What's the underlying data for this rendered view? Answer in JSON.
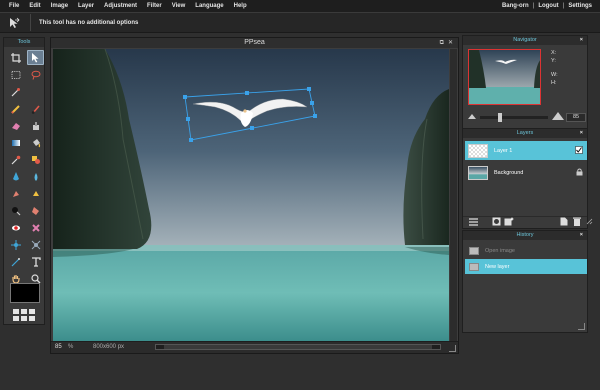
{
  "menubar": {
    "items": [
      "File",
      "Edit",
      "Image",
      "Layer",
      "Adjustment",
      "Filter",
      "View",
      "Language",
      "Help"
    ],
    "account": {
      "user": "Bang-orn",
      "logout": "Logout",
      "settings": "Settings",
      "sep": "|"
    }
  },
  "optionsbar": {
    "message": "This tool has no additional options",
    "tool_icon": "move-icon"
  },
  "tools": {
    "title": "Tools",
    "items": [
      "crop-icon",
      "move-icon",
      "marquee-icon",
      "lasso-icon",
      "wand-icon",
      "pencil-icon",
      "brush-icon",
      "clone-icon",
      "eraser-icon",
      "bucket-icon",
      "gradient-icon",
      "colorpicker-icon",
      "drawing-icon",
      "burn-icon",
      "blur-icon",
      "sharpen-icon",
      "smudge-icon",
      "sponge-icon",
      "dodge-icon",
      "redeye-icon",
      "spot-heal-icon",
      "bloat-icon",
      "pinch-icon",
      "line-icon",
      "text-icon",
      "hand-icon",
      "zoom-icon"
    ],
    "active": "move-icon",
    "swatch_color": "#000000"
  },
  "canvas": {
    "title": "PPsea",
    "zoom": "85",
    "zoom_unit": "%",
    "dims": "800x600 px"
  },
  "navigator": {
    "title": "Navigator",
    "close": "×",
    "x_label": "X:",
    "y_label": "Y:",
    "w_label": "W:",
    "h_label": "H:",
    "zoom": "85"
  },
  "layers": {
    "title": "Layers",
    "close": "×",
    "items": [
      {
        "name": "Layer 1",
        "selected": true,
        "mark": "checkbox-icon"
      },
      {
        "name": "Background",
        "selected": false,
        "mark": "lock-icon"
      }
    ]
  },
  "history": {
    "title": "History",
    "close": "×",
    "items": [
      {
        "label": "Open image",
        "selected": false
      },
      {
        "label": "New layer",
        "selected": true
      }
    ]
  },
  "colors": {
    "accent": "#58c3d8",
    "title": "#6cc4d8",
    "bg": "#2f2f2f"
  }
}
